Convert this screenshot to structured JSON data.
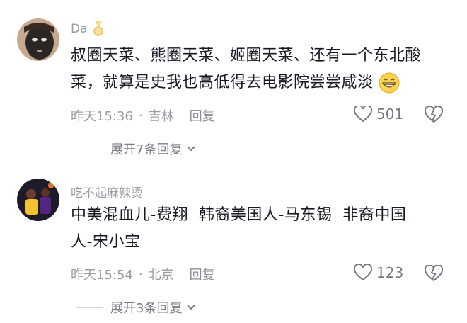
{
  "comments": [
    {
      "username": "Da",
      "badge_icon": "medal-icon",
      "text_line1": "叔圈天菜、熊圈天菜、姬圈天菜、还有一个东北酸",
      "text_line2": "菜，就算是史我也高低得去电影院尝尝咸淡",
      "emoji_icon": "grinning-face-icon",
      "time": "昨天15:36",
      "location": "吉林",
      "reply_label": "回复",
      "likes": "501",
      "expand_label": "展开7条回复"
    },
    {
      "username": "吃不起麻辣烫",
      "text_line1": "中美混血儿-费翔  韩裔美国人-马东锡  非裔中国",
      "text_line2": "人-宋小宝",
      "time": "昨天15:54",
      "location": "北京",
      "reply_label": "回复",
      "likes": "123",
      "expand_label": "展开3条回复"
    }
  ],
  "colors": {
    "text": "#161823",
    "muted": "#9a9ca3",
    "icon": "#767882"
  }
}
